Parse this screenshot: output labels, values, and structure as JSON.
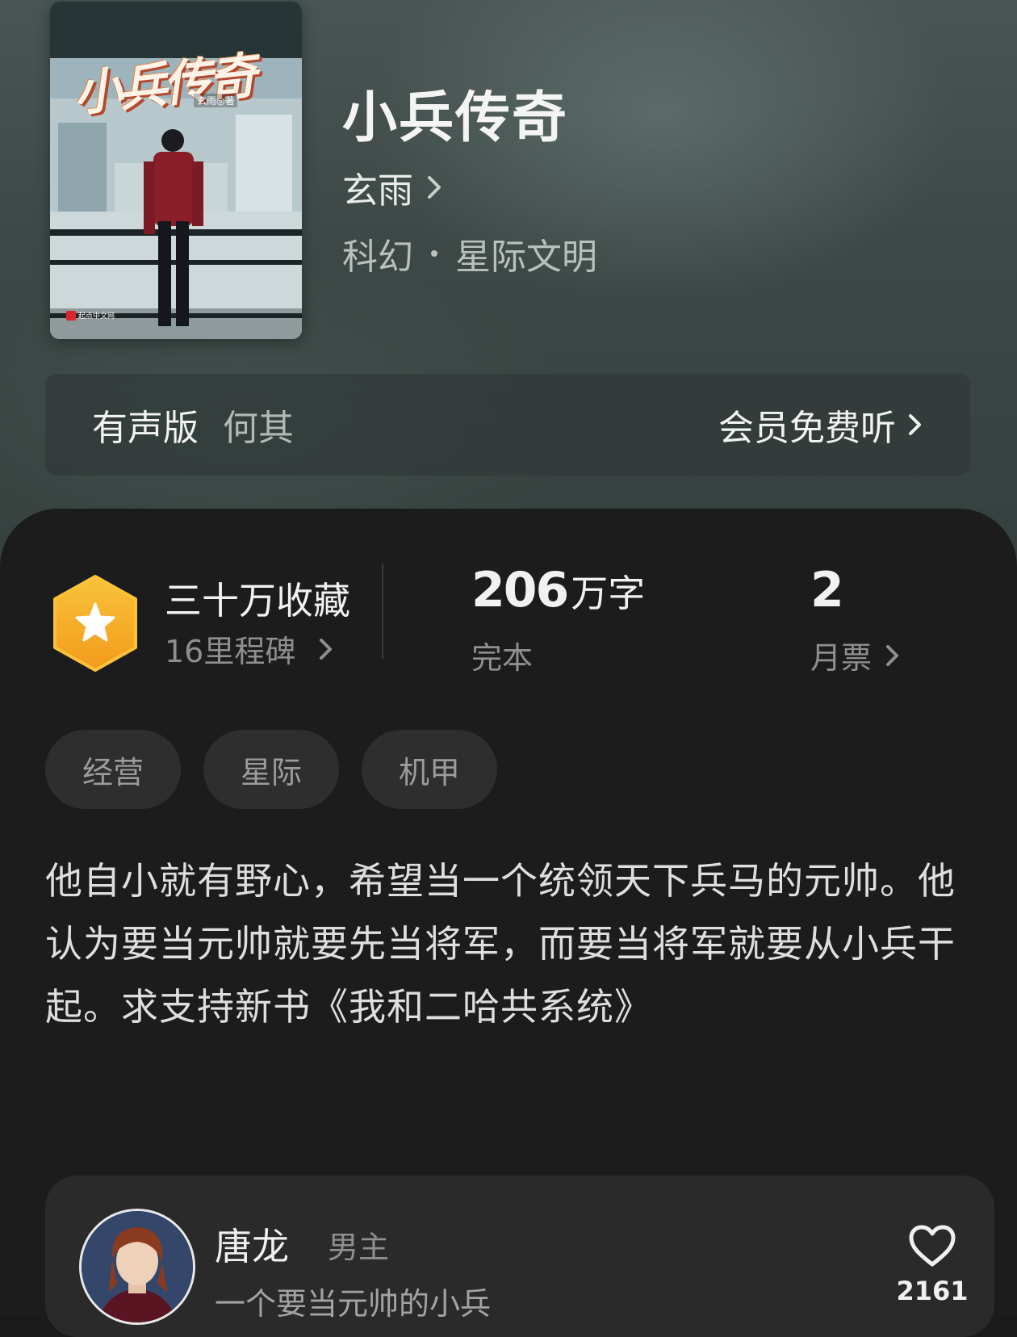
{
  "book": {
    "title": "小兵传奇",
    "author": "玄雨",
    "category": "科幻",
    "subcategory": "星际文明",
    "cover": {
      "title_art": "小兵传奇",
      "author_art": "玄雨◎著",
      "publisher": "起点中文网"
    }
  },
  "audio": {
    "label": "有声版",
    "narrator": "何其",
    "action": "会员免费听"
  },
  "stats": {
    "favorites": "三十万收藏",
    "milestone": "16里程碑",
    "word_count": "206",
    "word_unit": "万字",
    "status": "完本",
    "monthly_votes": "2",
    "monthly_votes_label": "月票"
  },
  "tags": [
    "经营",
    "星际",
    "机甲"
  ],
  "synopsis": "他自小就有野心，希望当一个统领天下兵马的元帅。他认为要当元帅就要先当将军，而要当将军就要从小兵干起。求支持新书《我和二哈共系统》",
  "character": {
    "name": "唐龙",
    "role": "男主",
    "description": "一个要当元帅的小兵",
    "likes": "2161"
  },
  "colors": {
    "badge": "#f6b02d",
    "panel": "#1c1c1d",
    "hero": "#3d4846"
  },
  "icons": [
    "chevron-right-icon",
    "star-badge-icon",
    "heart-icon"
  ]
}
